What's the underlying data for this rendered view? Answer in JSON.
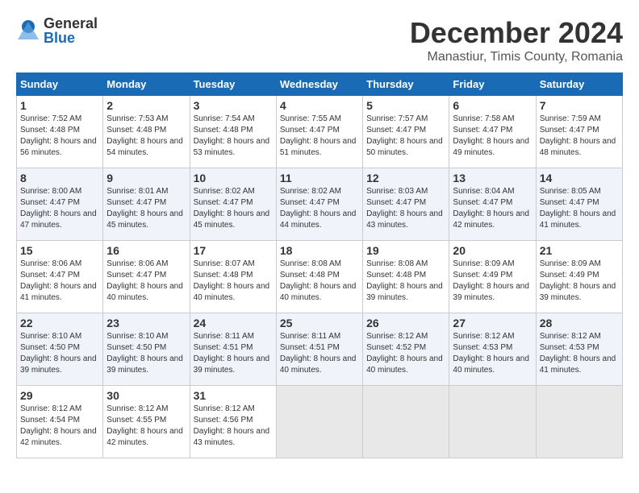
{
  "logo": {
    "general": "General",
    "blue": "Blue"
  },
  "title": "December 2024",
  "location": "Manastiur, Timis County, Romania",
  "weekdays": [
    "Sunday",
    "Monday",
    "Tuesday",
    "Wednesday",
    "Thursday",
    "Friday",
    "Saturday"
  ],
  "weeks": [
    [
      {
        "day": "1",
        "sunrise": "Sunrise: 7:52 AM",
        "sunset": "Sunset: 4:48 PM",
        "daylight": "Daylight: 8 hours and 56 minutes."
      },
      {
        "day": "2",
        "sunrise": "Sunrise: 7:53 AM",
        "sunset": "Sunset: 4:48 PM",
        "daylight": "Daylight: 8 hours and 54 minutes."
      },
      {
        "day": "3",
        "sunrise": "Sunrise: 7:54 AM",
        "sunset": "Sunset: 4:48 PM",
        "daylight": "Daylight: 8 hours and 53 minutes."
      },
      {
        "day": "4",
        "sunrise": "Sunrise: 7:55 AM",
        "sunset": "Sunset: 4:47 PM",
        "daylight": "Daylight: 8 hours and 51 minutes."
      },
      {
        "day": "5",
        "sunrise": "Sunrise: 7:57 AM",
        "sunset": "Sunset: 4:47 PM",
        "daylight": "Daylight: 8 hours and 50 minutes."
      },
      {
        "day": "6",
        "sunrise": "Sunrise: 7:58 AM",
        "sunset": "Sunset: 4:47 PM",
        "daylight": "Daylight: 8 hours and 49 minutes."
      },
      {
        "day": "7",
        "sunrise": "Sunrise: 7:59 AM",
        "sunset": "Sunset: 4:47 PM",
        "daylight": "Daylight: 8 hours and 48 minutes."
      }
    ],
    [
      {
        "day": "8",
        "sunrise": "Sunrise: 8:00 AM",
        "sunset": "Sunset: 4:47 PM",
        "daylight": "Daylight: 8 hours and 47 minutes."
      },
      {
        "day": "9",
        "sunrise": "Sunrise: 8:01 AM",
        "sunset": "Sunset: 4:47 PM",
        "daylight": "Daylight: 8 hours and 45 minutes."
      },
      {
        "day": "10",
        "sunrise": "Sunrise: 8:02 AM",
        "sunset": "Sunset: 4:47 PM",
        "daylight": "Daylight: 8 hours and 45 minutes."
      },
      {
        "day": "11",
        "sunrise": "Sunrise: 8:02 AM",
        "sunset": "Sunset: 4:47 PM",
        "daylight": "Daylight: 8 hours and 44 minutes."
      },
      {
        "day": "12",
        "sunrise": "Sunrise: 8:03 AM",
        "sunset": "Sunset: 4:47 PM",
        "daylight": "Daylight: 8 hours and 43 minutes."
      },
      {
        "day": "13",
        "sunrise": "Sunrise: 8:04 AM",
        "sunset": "Sunset: 4:47 PM",
        "daylight": "Daylight: 8 hours and 42 minutes."
      },
      {
        "day": "14",
        "sunrise": "Sunrise: 8:05 AM",
        "sunset": "Sunset: 4:47 PM",
        "daylight": "Daylight: 8 hours and 41 minutes."
      }
    ],
    [
      {
        "day": "15",
        "sunrise": "Sunrise: 8:06 AM",
        "sunset": "Sunset: 4:47 PM",
        "daylight": "Daylight: 8 hours and 41 minutes."
      },
      {
        "day": "16",
        "sunrise": "Sunrise: 8:06 AM",
        "sunset": "Sunset: 4:47 PM",
        "daylight": "Daylight: 8 hours and 40 minutes."
      },
      {
        "day": "17",
        "sunrise": "Sunrise: 8:07 AM",
        "sunset": "Sunset: 4:48 PM",
        "daylight": "Daylight: 8 hours and 40 minutes."
      },
      {
        "day": "18",
        "sunrise": "Sunrise: 8:08 AM",
        "sunset": "Sunset: 4:48 PM",
        "daylight": "Daylight: 8 hours and 40 minutes."
      },
      {
        "day": "19",
        "sunrise": "Sunrise: 8:08 AM",
        "sunset": "Sunset: 4:48 PM",
        "daylight": "Daylight: 8 hours and 39 minutes."
      },
      {
        "day": "20",
        "sunrise": "Sunrise: 8:09 AM",
        "sunset": "Sunset: 4:49 PM",
        "daylight": "Daylight: 8 hours and 39 minutes."
      },
      {
        "day": "21",
        "sunrise": "Sunrise: 8:09 AM",
        "sunset": "Sunset: 4:49 PM",
        "daylight": "Daylight: 8 hours and 39 minutes."
      }
    ],
    [
      {
        "day": "22",
        "sunrise": "Sunrise: 8:10 AM",
        "sunset": "Sunset: 4:50 PM",
        "daylight": "Daylight: 8 hours and 39 minutes."
      },
      {
        "day": "23",
        "sunrise": "Sunrise: 8:10 AM",
        "sunset": "Sunset: 4:50 PM",
        "daylight": "Daylight: 8 hours and 39 minutes."
      },
      {
        "day": "24",
        "sunrise": "Sunrise: 8:11 AM",
        "sunset": "Sunset: 4:51 PM",
        "daylight": "Daylight: 8 hours and 39 minutes."
      },
      {
        "day": "25",
        "sunrise": "Sunrise: 8:11 AM",
        "sunset": "Sunset: 4:51 PM",
        "daylight": "Daylight: 8 hours and 40 minutes."
      },
      {
        "day": "26",
        "sunrise": "Sunrise: 8:12 AM",
        "sunset": "Sunset: 4:52 PM",
        "daylight": "Daylight: 8 hours and 40 minutes."
      },
      {
        "day": "27",
        "sunrise": "Sunrise: 8:12 AM",
        "sunset": "Sunset: 4:53 PM",
        "daylight": "Daylight: 8 hours and 40 minutes."
      },
      {
        "day": "28",
        "sunrise": "Sunrise: 8:12 AM",
        "sunset": "Sunset: 4:53 PM",
        "daylight": "Daylight: 8 hours and 41 minutes."
      }
    ],
    [
      {
        "day": "29",
        "sunrise": "Sunrise: 8:12 AM",
        "sunset": "Sunset: 4:54 PM",
        "daylight": "Daylight: 8 hours and 42 minutes."
      },
      {
        "day": "30",
        "sunrise": "Sunrise: 8:12 AM",
        "sunset": "Sunset: 4:55 PM",
        "daylight": "Daylight: 8 hours and 42 minutes."
      },
      {
        "day": "31",
        "sunrise": "Sunrise: 8:12 AM",
        "sunset": "Sunset: 4:56 PM",
        "daylight": "Daylight: 8 hours and 43 minutes."
      },
      null,
      null,
      null,
      null
    ]
  ]
}
